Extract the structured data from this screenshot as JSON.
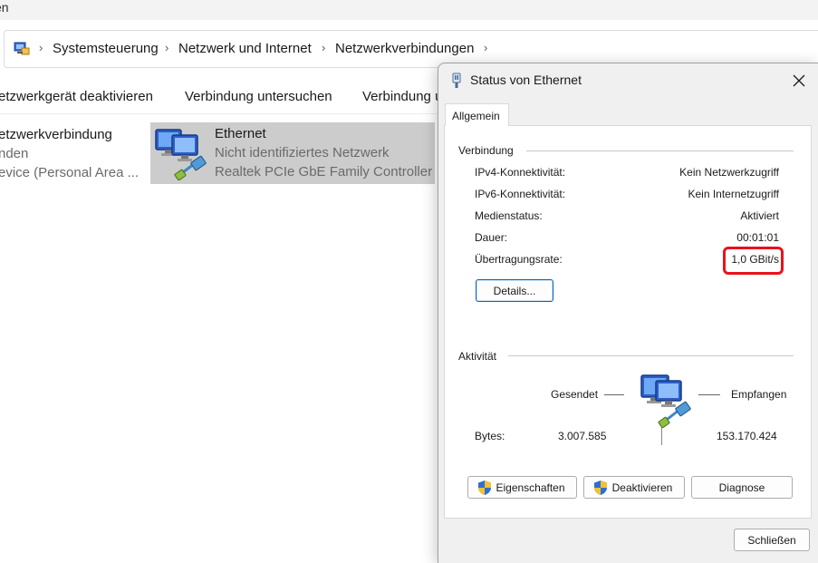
{
  "explorer": {
    "top_strip_text": "en",
    "breadcrumb": [
      "Systemsteuerung",
      "Netzwerk und Internet",
      "Netzwerkverbindungen"
    ],
    "commands": [
      "etzwerkgerät deaktivieren",
      "Verbindung untersuchen",
      "Verbindung u"
    ],
    "connections": [
      {
        "name": "etzwerkverbindung",
        "line2": "nden",
        "line3": "evice (Personal Area ..."
      },
      {
        "name": "Ethernet",
        "line2": "Nicht identifiziertes Netzwerk",
        "line3": "Realtek PCIe GbE Family Controller"
      }
    ]
  },
  "dialog": {
    "title": "Status von Ethernet",
    "tab": "Allgemein",
    "connection_group": "Verbindung",
    "rows": [
      {
        "label": "IPv4-Konnektivität:",
        "value": "Kein Netzwerkzugriff"
      },
      {
        "label": "IPv6-Konnektivität:",
        "value": "Kein Internetzugriff"
      },
      {
        "label": "Medienstatus:",
        "value": "Aktiviert"
      },
      {
        "label": "Dauer:",
        "value": "00:01:01"
      },
      {
        "label": "Übertragungsrate:",
        "value": "1,0 GBit/s"
      }
    ],
    "details_button": "Details...",
    "activity_group": "Aktivität",
    "sent_label": "Gesendet",
    "received_label": "Empfangen",
    "bytes_label": "Bytes:",
    "bytes_sent": "3.007.585",
    "bytes_received": "153.170.424",
    "buttons": {
      "properties": "Eigenschaften",
      "disable": "Deaktivieren",
      "diagnose": "Diagnose",
      "close": "Schließen"
    }
  },
  "colors": {
    "highlight": "#e8121c",
    "selected_item": "#cccccc",
    "dialog_bg": "#f0f0f0",
    "accent": "#0067c0"
  },
  "icons": [
    "control-panel-icon",
    "chevron-right-icon",
    "network-adapter-icon",
    "ethernet-connector-icon",
    "close-icon",
    "uac-shield-icon",
    "network-activity-icon"
  ]
}
